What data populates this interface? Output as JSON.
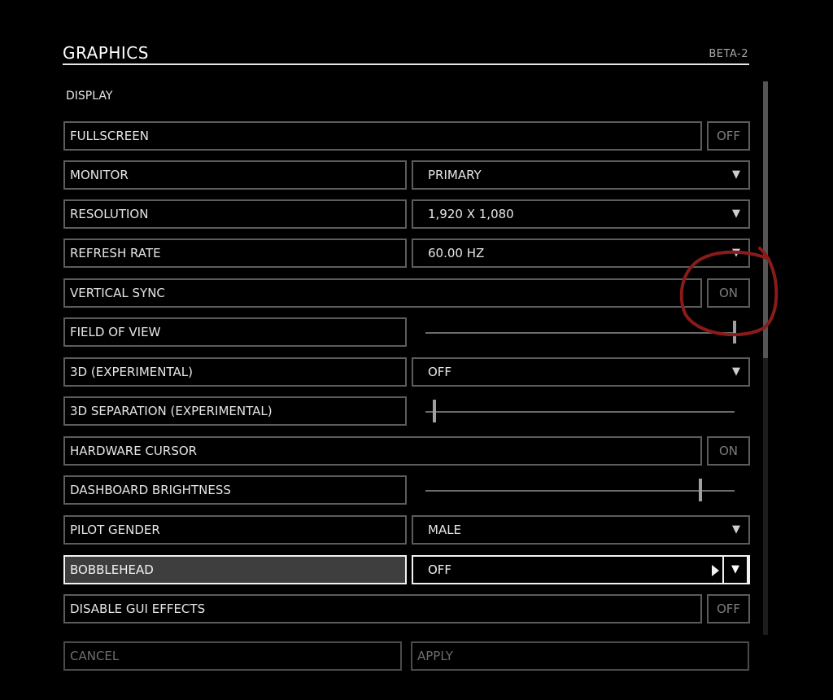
{
  "header": {
    "title": "GRAPHICS",
    "version": "BETA-2"
  },
  "section": {
    "title": "DISPLAY"
  },
  "settings": [
    {
      "label": "FULLSCREEN",
      "type": "toggle",
      "value": "OFF"
    },
    {
      "label": "MONITOR",
      "type": "dropdown",
      "value": "PRIMARY"
    },
    {
      "label": "RESOLUTION",
      "type": "dropdown",
      "value": "1,920 X 1,080"
    },
    {
      "label": "REFRESH RATE",
      "type": "dropdown",
      "value": "60.00 HZ"
    },
    {
      "label": "VERTICAL SYNC",
      "type": "toggle",
      "value": "ON"
    },
    {
      "label": "FIELD OF VIEW",
      "type": "slider",
      "level": 1.0
    },
    {
      "label": "3D (EXPERIMENTAL)",
      "type": "dropdown",
      "value": "OFF"
    },
    {
      "label": "3D SEPARATION (EXPERIMENTAL)",
      "type": "slider",
      "level": 0.03
    },
    {
      "label": "HARDWARE CURSOR",
      "type": "toggle",
      "value": "ON"
    },
    {
      "label": "DASHBOARD BRIGHTNESS",
      "type": "slider",
      "level": 0.89
    },
    {
      "label": "PILOT GENDER",
      "type": "dropdown",
      "value": "MALE"
    },
    {
      "label": "BOBBLEHEAD",
      "type": "dropdown",
      "value": "OFF"
    },
    {
      "label": "DISABLE GUI EFFECTS",
      "type": "toggle",
      "value": "OFF"
    }
  ],
  "footer": {
    "cancel_label": "CANCEL",
    "apply_label": "APPLY"
  },
  "annotation": {
    "color": "#8b1a1a"
  },
  "icons": {
    "dropdown": "chevron-down-icon",
    "submenu": "caret-right-icon"
  }
}
